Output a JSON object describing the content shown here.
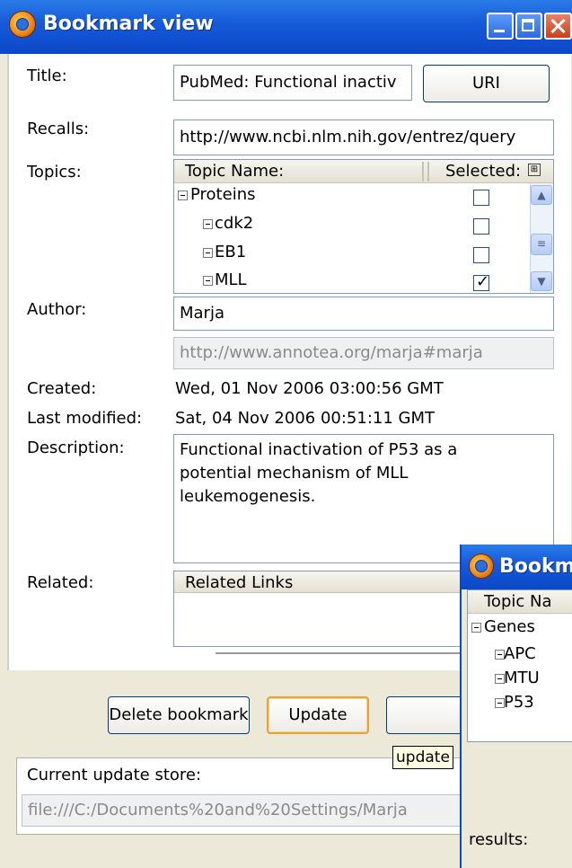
{
  "window": {
    "title": "Bookmark view",
    "icon": "firefox-icon"
  },
  "form": {
    "title_label": "Title:",
    "title_value": "PubMed: Functional inactiv",
    "uri_button": "URI",
    "recalls_label": "Recalls:",
    "recalls_value": "http://www.ncbi.nlm.nih.gov/entrez/query",
    "topics_label": "Topics:",
    "author_label": "Author:",
    "author_value": "Marja",
    "author_uri": "http://www.annotea.org/marja#marja",
    "created_label": "Created:",
    "created_value": "Wed, 01 Nov 2006 03:00:56 GMT",
    "modified_label": "Last modified:",
    "modified_value": "Sat, 04 Nov 2006 00:51:11 GMT",
    "description_label": "Description:",
    "description_lines": [
      "Functional inactivation of P53 as a",
      "potential mechanism of MLL",
      "leukemogenesis."
    ],
    "related_label": "Related:",
    "related_header": "Related Links"
  },
  "topics": {
    "col_name": "Topic Name:",
    "col_selected": "Selected:",
    "rows": [
      {
        "name": "Proteins",
        "selected": false
      },
      {
        "name": "cdk2",
        "selected": false
      },
      {
        "name": "EB1",
        "selected": false
      },
      {
        "name": "MLL",
        "selected": true
      }
    ]
  },
  "actions": {
    "delete": "Delete bookmark",
    "update": "Update"
  },
  "store": {
    "label": "Current update store:",
    "value": "file:///C:/Documents%20and%20Settings/Marja"
  },
  "tooltip": "update",
  "second_window": {
    "title": "Bookma",
    "col_header": "Topic Na",
    "items": [
      "Genes",
      "APC",
      "MTU",
      "P53"
    ],
    "results_label": "results:"
  }
}
